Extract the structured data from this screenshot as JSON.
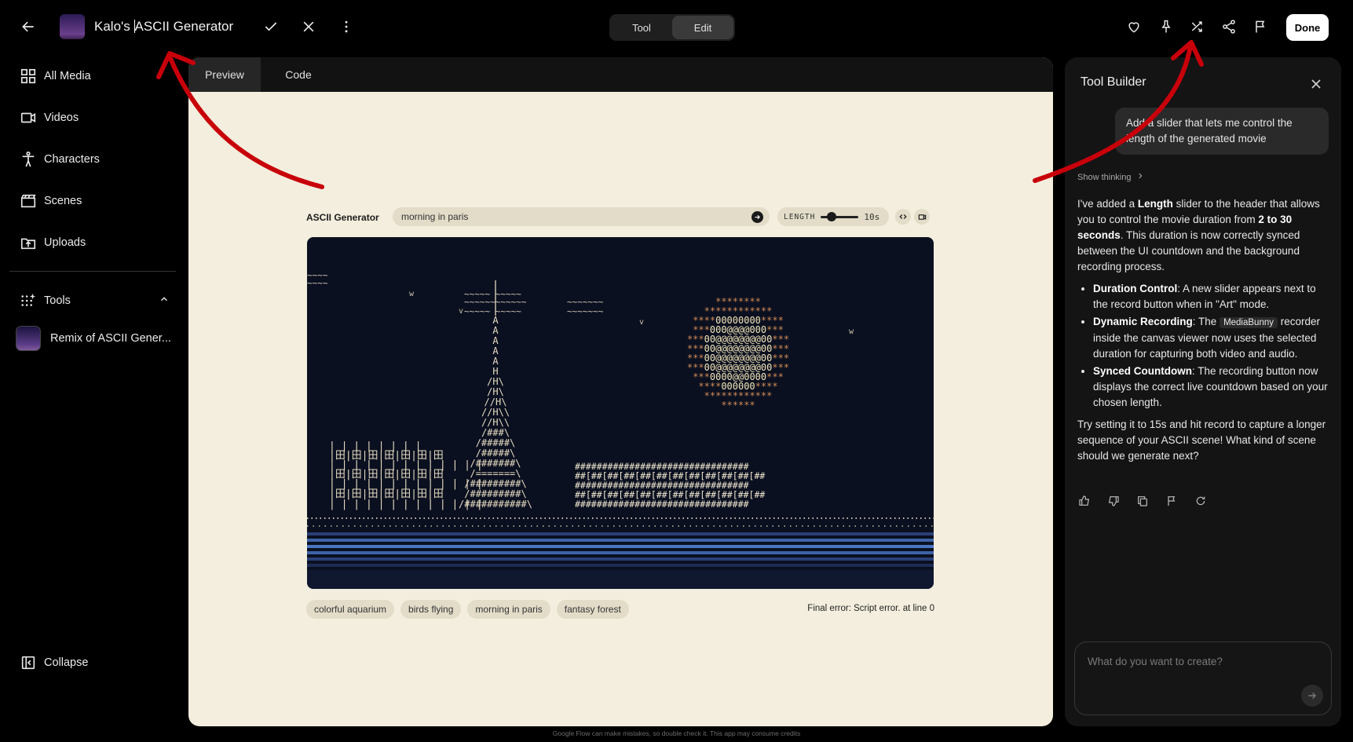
{
  "topbar": {
    "title_before_cursor": "Kalo's ",
    "title_after_cursor": "ASCII Generator",
    "mode_tabs": [
      {
        "label": "Tool"
      },
      {
        "label": "Edit"
      }
    ],
    "done_label": "Done"
  },
  "sidebar": {
    "items": [
      {
        "label": "All Media",
        "icon": "grid-icon"
      },
      {
        "label": "Videos",
        "icon": "video-icon"
      },
      {
        "label": "Characters",
        "icon": "person-icon"
      },
      {
        "label": "Scenes",
        "icon": "clapperboard-icon"
      },
      {
        "label": "Uploads",
        "icon": "upload-icon"
      }
    ],
    "tools_label": "Tools",
    "remix_label": "Remix of ASCII Gener...",
    "collapse_label": "Collapse"
  },
  "main": {
    "tabs": [
      {
        "label": "Preview"
      },
      {
        "label": "Code"
      }
    ],
    "ascii_app": {
      "title": "ASCII Generator",
      "prompt_value": "morning in paris",
      "length_label": "LENGTH",
      "length_value": "10s",
      "length_fraction": 0.29,
      "chips": [
        "colorful aquarium",
        "birds flying",
        "morning in paris",
        "fantasy forest"
      ],
      "error": "Final error: Script error. at line 0"
    }
  },
  "panel": {
    "title": "Tool Builder",
    "user_message": "Add a slider that lets me control the length of the generated movie",
    "show_thinking": "Show thinking",
    "reply": {
      "intro_1": "I've added a ",
      "intro_bold_1": "Length",
      "intro_2": " slider to the header that allows you to control the movie duration from ",
      "intro_bold_2": "2 to 30 seconds",
      "intro_3": ". This duration is now correctly synced between the UI countdown and the background recording process.",
      "bullets": [
        {
          "bold": "Duration Control",
          "text": ": A new slider appears next to the record button when in \"Art\" mode."
        },
        {
          "bold": "Dynamic Recording",
          "text_before": ": The ",
          "code": "MediaBunny",
          "text": " recorder inside the canvas viewer now uses the selected duration for capturing both video and audio."
        },
        {
          "bold": "Synced Countdown",
          "text": ": The recording button now displays the correct live countdown based on your chosen length."
        }
      ],
      "outro": "Try setting it to 15s and hit record to capture a longer sequence of your ASCII scene! What kind of scene should we generate next?"
    },
    "compose_placeholder": "What do you want to create?"
  },
  "disclaimer": "Google Flow can make mistakes, so double check it. This app may consume credits",
  "colors": {
    "accent_red": "#c8000a",
    "canvas_bg": "#0b1020",
    "sun_inner": "#f3e6b8",
    "sun_outer": "#d08a55",
    "ascii_light": "#efe7cf",
    "water": "#3d63a8"
  }
}
